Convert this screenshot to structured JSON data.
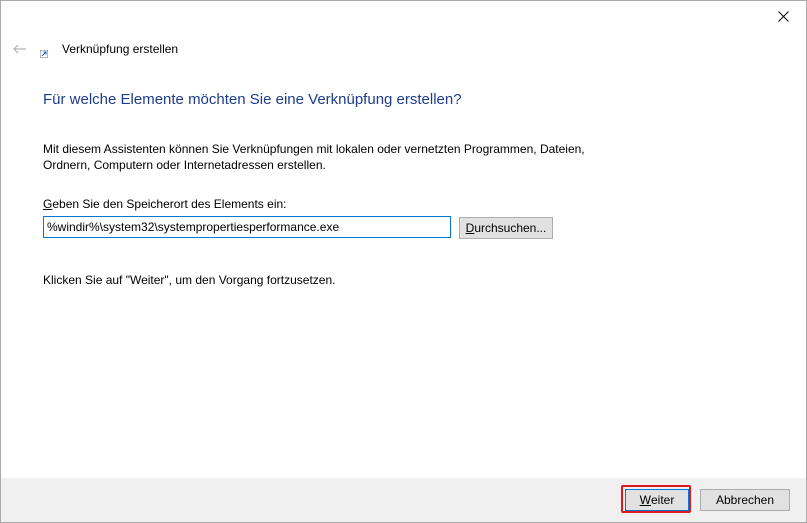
{
  "window": {
    "close_glyph": "close-icon"
  },
  "wizard": {
    "back_icon": "back-arrow-icon",
    "app_icon": "shortcut-icon",
    "title": "Verknüpfung erstellen",
    "heading": "Für welche Elemente möchten Sie eine Verknüpfung erstellen?",
    "description_line1": "Mit diesem Assistenten können Sie Verknüpfungen mit lokalen oder vernetzten Programmen, Dateien,",
    "description_line2": "Ordnern, Computern oder Internetadressen erstellen.",
    "location_label_accel": "G",
    "location_label_rest": "eben Sie den Speicherort des Elements ein:",
    "location_value": "%windir%\\system32\\systempropertiesperformance.exe",
    "browse_accel": "D",
    "browse_rest": "urchsuchen...",
    "hint": "Klicken Sie auf \"Weiter\", um den Vorgang fortzusetzen."
  },
  "footer": {
    "next_accel": "W",
    "next_rest": "eiter",
    "cancel_label": "Abbrechen"
  },
  "colors": {
    "heading": "#1c3c8c",
    "focus": "#0078d7",
    "highlight": "#e0181e",
    "footer_bg": "#f0f0f0"
  }
}
